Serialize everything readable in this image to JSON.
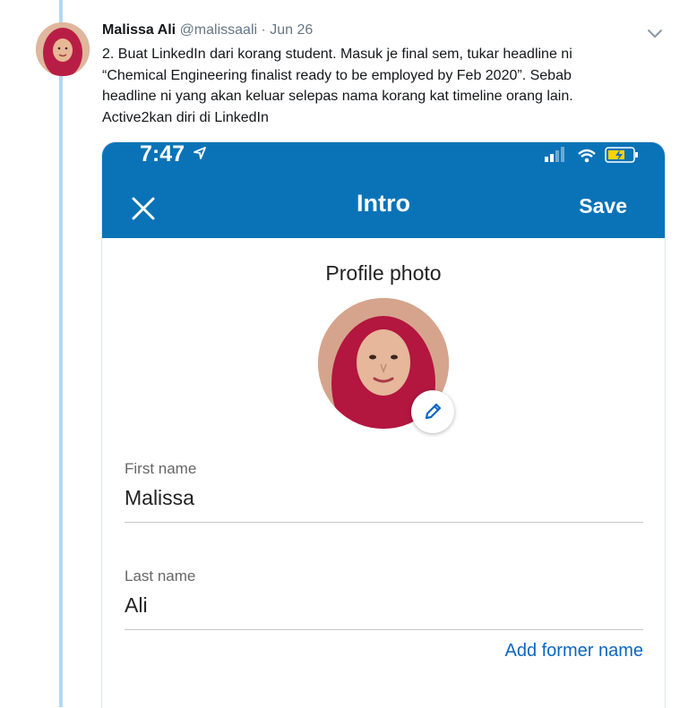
{
  "tweet": {
    "author_name": "Malissa Ali",
    "handle": "@malissaali",
    "separator": "·",
    "date": "Jun 26",
    "text_lines": [
      "2. Buat LinkedIn dari korang student. Masuk je final sem, tukar headline ni",
      "“Chemical Engineering finalist ready to be employed by Feb 2020”. Sebab",
      "headline ni yang akan keluar selepas nama korang kat timeline orang lain.",
      "Active2kan diri di LinkedIn"
    ],
    "chevron_icon": "chevron-down-icon"
  },
  "phone": {
    "status_bar": {
      "time": "7:47"
    },
    "app_bar": {
      "title": "Intro",
      "save_label": "Save",
      "close_icon": "close-icon"
    },
    "profile_photo_label": "Profile photo",
    "fields": {
      "first_name": {
        "label": "First name",
        "value": "Malissa"
      },
      "last_name": {
        "label": "Last name",
        "value": "Ali"
      }
    },
    "add_former_name_label": "Add former name"
  },
  "colors": {
    "linkedin_blue": "#0a73b7",
    "link_blue": "#0a66c2",
    "thread_line": "#b5d7f2",
    "twitter_gray": "#657786"
  }
}
